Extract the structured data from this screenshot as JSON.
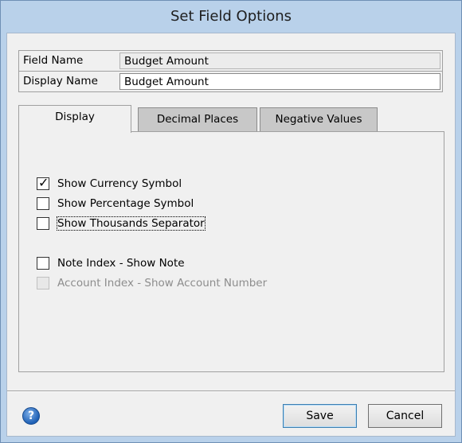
{
  "window": {
    "title": "Set Field Options"
  },
  "fields": {
    "field_name_label": "Field Name",
    "field_name_value": "Budget Amount",
    "display_name_label": "Display Name",
    "display_name_value": "Budget Amount"
  },
  "tabs": [
    {
      "label": "Display",
      "active": true
    },
    {
      "label": "Decimal Places",
      "active": false
    },
    {
      "label": "Negative Values",
      "active": false
    }
  ],
  "options": [
    {
      "label": "Show Currency Symbol",
      "checked": true,
      "enabled": true
    },
    {
      "label": "Show Percentage Symbol",
      "checked": false,
      "enabled": true
    },
    {
      "label": "Show Thousands Separator",
      "checked": false,
      "enabled": true,
      "focused": true
    },
    {
      "label": "Note Index - Show Note",
      "checked": false,
      "enabled": true
    },
    {
      "label": "Account Index - Show Account Number",
      "checked": false,
      "enabled": false
    }
  ],
  "buttons": {
    "save": "Save",
    "cancel": "Cancel",
    "help_icon": "help-icon"
  }
}
